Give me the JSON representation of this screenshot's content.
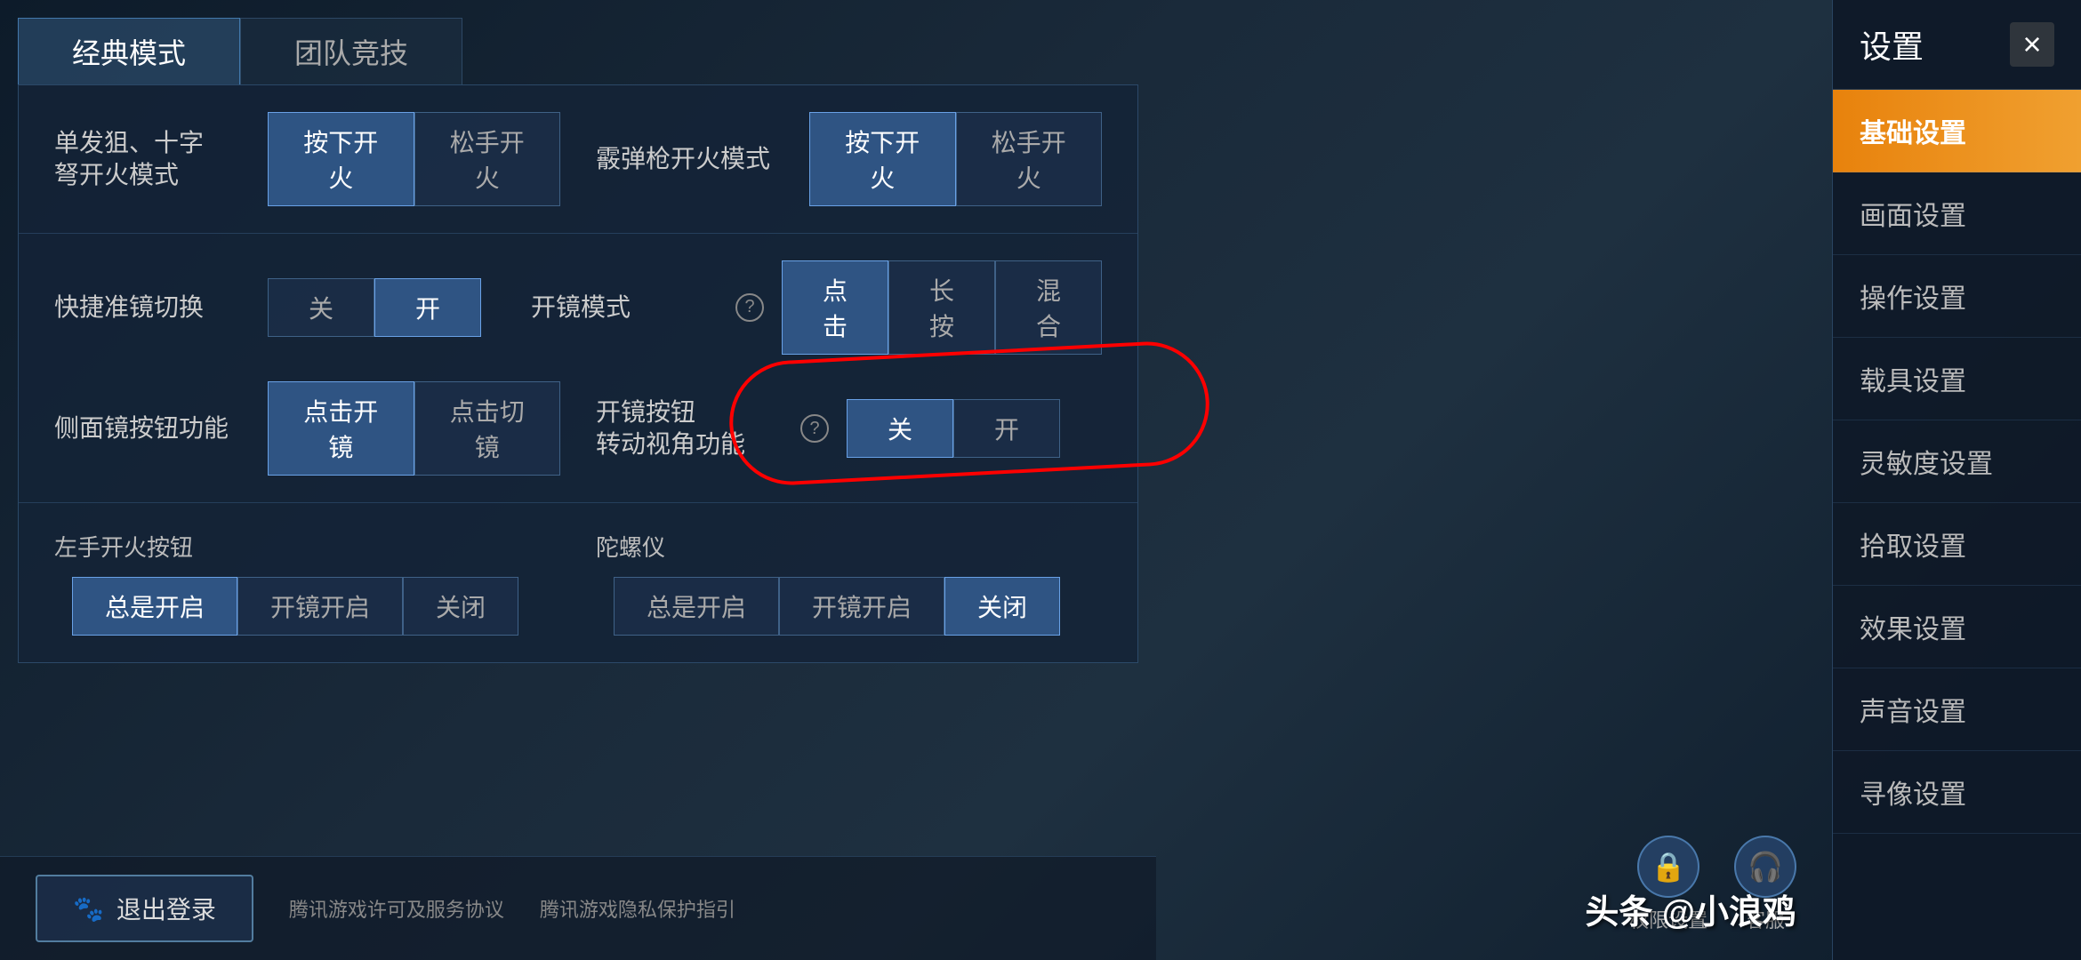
{
  "tabs": [
    {
      "label": "经典模式",
      "active": true
    },
    {
      "label": "团队竞技",
      "active": false
    }
  ],
  "sections": {
    "single_shot": {
      "label": "单发狙、十字\n弩开火模式",
      "buttons": [
        "按下开火",
        "松手开火"
      ],
      "霰弹枪label": "霰弹枪开火模式",
      "霰弹枪buttons": [
        "按下开火",
        "松手开火"
      ]
    },
    "scope": {
      "quick_scope_label": "快捷准镜切换",
      "quick_scope_buttons": [
        {
          "label": "关",
          "active": false
        },
        {
          "label": "开",
          "active": true
        }
      ],
      "scope_mode_label": "开镜模式",
      "scope_mode_buttons": [
        {
          "label": "点击",
          "active": true
        },
        {
          "label": "长按",
          "active": false
        },
        {
          "label": "混合",
          "active": false
        }
      ],
      "side_scope_label": "侧面镜按钮功能",
      "side_scope_buttons": [
        {
          "label": "点击开镜",
          "active": true
        },
        {
          "label": "点击切镜",
          "active": false
        }
      ],
      "scope_rotate_label": "开镜按钮\n转动视角功能",
      "scope_rotate_buttons": [
        {
          "label": "关",
          "active": true
        },
        {
          "label": "开",
          "active": false
        }
      ]
    },
    "fire": {
      "left_fire_label": "左手开火按钮",
      "left_fire_buttons": [
        {
          "label": "总是开启",
          "active": true
        },
        {
          "label": "开镜开启",
          "active": false
        },
        {
          "label": "关闭",
          "active": false
        }
      ],
      "gyro_label": "陀螺仪",
      "gyro_buttons": [
        {
          "label": "总是开启",
          "active": false
        },
        {
          "label": "开镜开启",
          "active": false
        },
        {
          "label": "关闭",
          "active": true
        }
      ]
    }
  },
  "sidebar": {
    "title": "设置",
    "close": "×",
    "items": [
      {
        "label": "基础设置",
        "active": true
      },
      {
        "label": "画面设置",
        "active": false
      },
      {
        "label": "操作设置",
        "active": false
      },
      {
        "label": "载具设置",
        "active": false
      },
      {
        "label": "灵敏度设置",
        "active": false
      },
      {
        "label": "拾取设置",
        "active": false
      },
      {
        "label": "效果设置",
        "active": false
      },
      {
        "label": "声音设置",
        "active": false
      },
      {
        "label": "寻像设置",
        "active": false
      }
    ]
  },
  "bottom": {
    "logout": "退出登录",
    "link1": "腾讯游戏许可及服务协议",
    "link2": "腾讯游戏隐私保护指引",
    "icon1_label": "权限设置",
    "icon2_label": "客服"
  },
  "watermark": "头条 @小浪鸡"
}
